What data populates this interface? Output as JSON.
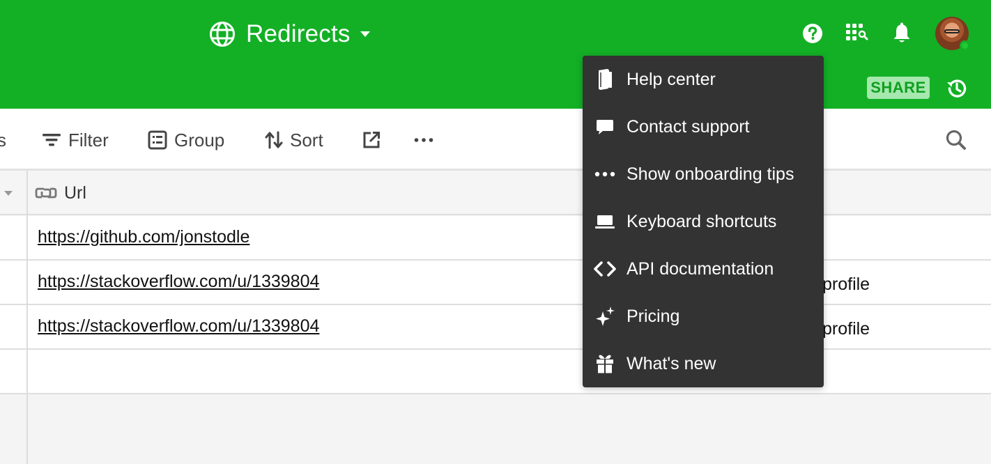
{
  "header": {
    "base_name": "Redirects",
    "globe_icon": "globe-icon",
    "share_label": "SHARE",
    "colors": {
      "header_bg": "#13b026",
      "share_bg": "#a6e8ad",
      "share_text": "#0f9f20"
    }
  },
  "toolbar": {
    "cut_label": "s",
    "filter_label": "Filter",
    "group_label": "Group",
    "sort_label": "Sort",
    "more_label": "•••"
  },
  "grid": {
    "url_column": "Url",
    "rows": [
      {
        "url": "https://github.com/jonstodle",
        "extra": ""
      },
      {
        "url": "https://stackoverflow.com/u/1339804",
        "extra": "profile"
      },
      {
        "url": "https://stackoverflow.com/u/1339804",
        "extra": "profile"
      },
      {
        "url": "",
        "extra": ""
      }
    ]
  },
  "help_menu": {
    "items": [
      {
        "label": "Help center",
        "icon": "book-icon"
      },
      {
        "label": "Contact support",
        "icon": "chat-bubble-icon"
      },
      {
        "label": "Show onboarding tips",
        "icon": "dots-icon"
      },
      {
        "label": "Keyboard shortcuts",
        "icon": "laptop-icon"
      },
      {
        "label": "API documentation",
        "icon": "code-icon"
      },
      {
        "label": "Pricing",
        "icon": "sparkle-icon"
      },
      {
        "label": "What's new",
        "icon": "gift-icon"
      }
    ],
    "colors": {
      "menu_bg": "#333333",
      "menu_text": "#ffffff"
    }
  }
}
